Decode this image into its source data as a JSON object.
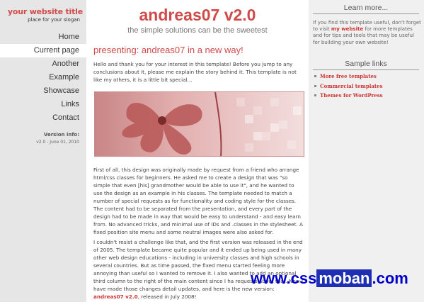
{
  "left": {
    "logo_title": "your website title",
    "logo_slogan": "place for your slogan",
    "nav": [
      {
        "label": "Home",
        "current": false
      },
      {
        "label": "Current page",
        "current": true
      },
      {
        "label": "Another",
        "current": false
      },
      {
        "label": "Example",
        "current": false
      },
      {
        "label": "Showcase",
        "current": false
      },
      {
        "label": "Links",
        "current": false
      },
      {
        "label": "Contact",
        "current": false
      }
    ],
    "version_label": "Version info:",
    "version_value": "v2.0 - June 01, 2010"
  },
  "main": {
    "title": "andreas07 v2.0",
    "slogan": "the simple solutions can be the sweetest",
    "post_heading": "presenting: andreas07 in a new way!",
    "p1": "Hello and thank you for your interest in this template! Before you jump to any conclusions about it, please me explain the story behind it. This template is not like my others, it is a little bit special...",
    "p2": "First of all, this design was originally made by request from a friend who arrange html/css classes for beginners. He asked me to create a design that was \"so simple that even [his] grandmother would be able to use it\", and he wanted to use the design as an example in his classes. The template needed to match a number of special requests as for functionality and coding style for the classes. The content had to be separated from the presentation, and every part of the design had to be made in way that would be easy to understand - and easy learn from. No advanced tricks, and minimal use of IDs and .classes in the stylesheet. A fixed position site menu and some neutral images were also asked for.",
    "p3_before": "I couldn't resist a challenge like that, and the first version was released in the end of 2005. The template became quite popular and it ended up being used in many other web design educations - including in university classes and high schools in several countries. But as time passed, the fixed menu started feeling more annoying than useful so I wanted to remove it. I also wanted to add an optional third column to the right of the main content since I ha",
    "p3_middle": " requests about that. Now I have made those changes ",
    "p3_detail": " detail updates, and here is the new version: ",
    "p3_link": "andreas07 v2.0",
    "p3_after": ", released in July 2008!"
  },
  "right": {
    "learn_heading": "Learn more...",
    "learn_text_before": "If you find this template useful, don't forget to visit ",
    "learn_link": "my website",
    "learn_text_after": " for more templates and for tips and tools that may be useful for building your own website!",
    "sample_heading": "Sample links",
    "sample_links": [
      "More free templates",
      "Commercial templates",
      "Themes for WordPress"
    ]
  },
  "watermark": {
    "prefix": "www.css",
    "highlight": "moban",
    "suffix": ".com"
  },
  "colors": {
    "accent": "#d04a4a",
    "link": "#cc3333",
    "left_bg": "#e6e6e6",
    "main_bg": "#ffffff",
    "right_bg": "#f0f0f0"
  }
}
